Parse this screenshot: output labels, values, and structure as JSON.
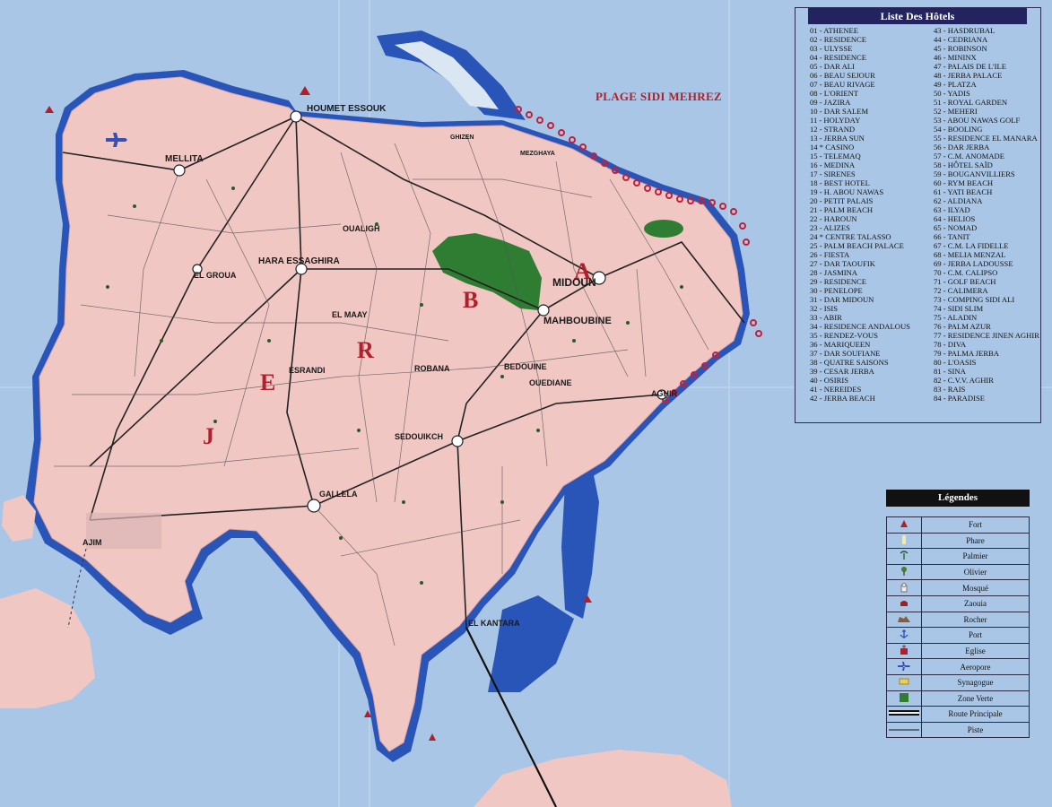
{
  "map": {
    "beach_label": "PLAGE SIDI MEHREZ",
    "island_letters": [
      "J",
      "E",
      "R",
      "B",
      "A"
    ],
    "towns": [
      {
        "name": "HOUMET ESSOUK"
      },
      {
        "name": "MELLITA"
      },
      {
        "name": "GHIZEN"
      },
      {
        "name": "MEZGHAYA"
      },
      {
        "name": "OUALIGH"
      },
      {
        "name": "HARA ESSAGHIRA"
      },
      {
        "name": "EL GROUA"
      },
      {
        "name": "EL MAAY"
      },
      {
        "name": "MIDOUN"
      },
      {
        "name": "MAHBOUBINE"
      },
      {
        "name": "ESRANDI"
      },
      {
        "name": "ROBANA"
      },
      {
        "name": "BEDOUINE"
      },
      {
        "name": "OUEDIANE"
      },
      {
        "name": "AGHIR"
      },
      {
        "name": "SEDOUIKCH"
      },
      {
        "name": "GALLELA"
      },
      {
        "name": "AJIM"
      },
      {
        "name": "EL KANTARA"
      }
    ],
    "colors": {
      "sea": "#a9c6e6",
      "land": "#f0c7c3",
      "shallow": "#2a55b8",
      "green_zone": "#2e7d32",
      "title_red": "#b0202c"
    }
  },
  "hotels": {
    "title": "Liste Des Hôtels",
    "col1": [
      "01 - ATHENEE",
      "02 - RESIDENCE",
      "03 - ULYSSE",
      "04 - RESIDENCE",
      "05 - DAR ALI",
      "06 - BEAU SEJOUR",
      "07 - BEAU RIVAGE",
      "08 - L'ORIENT",
      "09 - JAZIRA",
      "10 - DAR SALEM",
      "11 - HOLYDAY",
      "12 - STRAND",
      "13 - JERBA SUN",
      "14 * CASINO",
      "15 - TELEMAQ",
      "16 - MEDINA",
      "17 - SIRENES",
      "18 - BEST HOTEL",
      "19 - H. ABOU NAWAS",
      "20 - PETIT PALAIS",
      "21 - PALM BEACH",
      "22 - HAROUN",
      "23 - ALIZES",
      "24 * CENTRE TALASSO",
      "25 - PALM BEACH PALACE",
      "26 - FIESTA",
      "27 - DAR TAOUFIK",
      "28 - JASMINA",
      "29 - RESIDENCE",
      "30 - PENELOPE",
      "31 - DAR MIDOUN",
      "32 - ISIS",
      "33 - ABIR",
      "34 - RESIDENCE ANDALOUS",
      "35 - RENDEZ-VOUS",
      "36 - MARIQUEEN",
      "37 - DAR SOUFIANE",
      "38 - QUATRE SAISONS",
      "39 - CESAR JERBA",
      "40 - OSIRIS",
      "41 - NEREIDES",
      "42 - JERBA BEACH"
    ],
    "col2": [
      "43 - HASDRUBAL",
      "44 - CEDRIANA",
      "45 - ROBINSON",
      "46 - MININX",
      "47 - PALAIS DE L'ILE",
      "48 - JERBA PALACE",
      "49 - PLATZA",
      "50 - YADIS",
      "51 - ROYAL GARDEN",
      "52 - MEHERI",
      "53 - ABOU NAWAS GOLF",
      "54 - BOOLING",
      "55 - RESIDENCE EL MANARA",
      "56 - DAR JERBA",
      "57 - C.M. ANOMADE",
      "58 - HÔTEL SAÏD",
      "59 - BOUGANVILLIERS",
      "60 - RYM BEACH",
      "61 - YATI BEACH",
      "62 - ALDIANA",
      "63 - ILYAD",
      "64 - HELIOS",
      "65 - NOMAD",
      "66 - TANIT",
      "67 - C.M. LA FIDELLE",
      "68 - MELIA MENZAL",
      "69 - JERBA LADOUSSE",
      "70 - C.M. CALIPSO",
      "71 - GOLF BEACH",
      "72 - CALIMERA",
      "73 - COMPING SIDI ALI",
      "74 - SIDI SLIM",
      "75 - ALADIN",
      "76 - PALM AZUR",
      "77 - RESIDENCE JINEN AGHIR",
      "78 - DIVA",
      "79 - PALMA JERBA",
      "80 - L'OASIS",
      "81 - SINA",
      "82 - C.V.V. AGHIR",
      "83 - RAIS",
      "84 - PARADISE"
    ]
  },
  "legend": {
    "title": "Légendes",
    "items": [
      {
        "label": "Fort",
        "icon": "fort-icon"
      },
      {
        "label": "Phare",
        "icon": "lighthouse-icon"
      },
      {
        "label": "Palmier",
        "icon": "palm-icon"
      },
      {
        "label": "Olivier",
        "icon": "olive-tree-icon"
      },
      {
        "label": "Mosqué",
        "icon": "mosque-icon"
      },
      {
        "label": "Zaouia",
        "icon": "zaouia-icon"
      },
      {
        "label": "Rocher",
        "icon": "rock-icon"
      },
      {
        "label": "Port",
        "icon": "anchor-icon"
      },
      {
        "label": "Eglise",
        "icon": "church-icon"
      },
      {
        "label": "Aeropore",
        "icon": "airplane-icon"
      },
      {
        "label": "Synagogue",
        "icon": "synagogue-icon"
      },
      {
        "label": "Zone Verte",
        "icon": "green-zone-icon"
      },
      {
        "label": "Route Principale",
        "icon": "main-road-icon"
      },
      {
        "label": "Piste",
        "icon": "track-icon"
      }
    ]
  }
}
